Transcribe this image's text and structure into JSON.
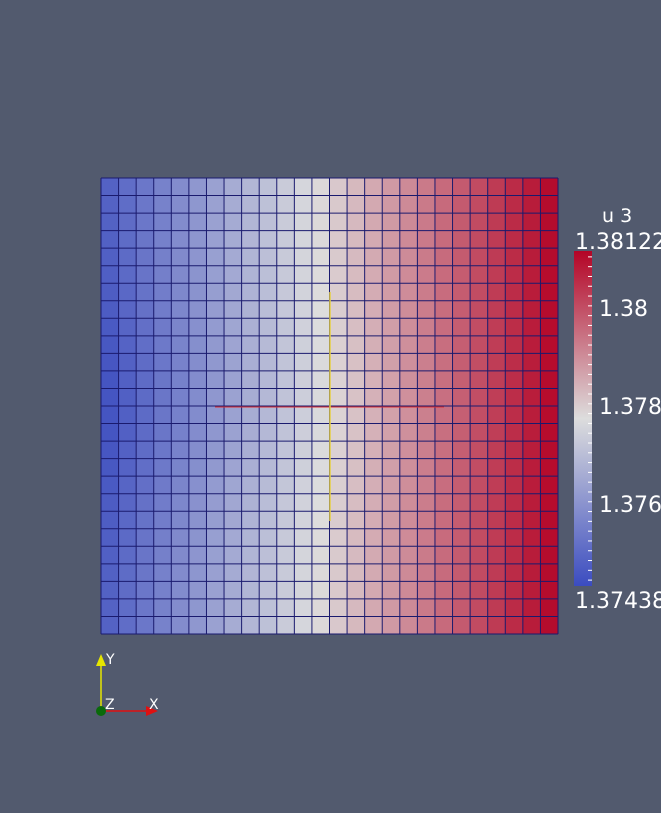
{
  "legend": {
    "title": "u 3",
    "max_label": "1.38122",
    "min_label": "1.37438",
    "range": [
      1.37438,
      1.38122
    ],
    "tick_labels": [
      {
        "value": 1.38,
        "label": "1.38"
      },
      {
        "value": 1.378,
        "label": "1.378"
      },
      {
        "value": 1.376,
        "label": "1.376"
      }
    ],
    "colormap": [
      "#3b4cc0",
      "#dddddd",
      "#b40426"
    ]
  },
  "mesh": {
    "columns": 26,
    "rows": 26,
    "edge_color": "#1a1a6e"
  },
  "orientation_axes": {
    "y_label": "Y",
    "z_label": "Z",
    "x_label": "X",
    "y_color": "#e6e600",
    "x_color": "#e01010",
    "origin_color": "#0a6a0a"
  },
  "colors": {
    "background": "#525a6e",
    "crosshair_horizontal": "#e03030",
    "crosshair_vertical": "#e6d040"
  }
}
